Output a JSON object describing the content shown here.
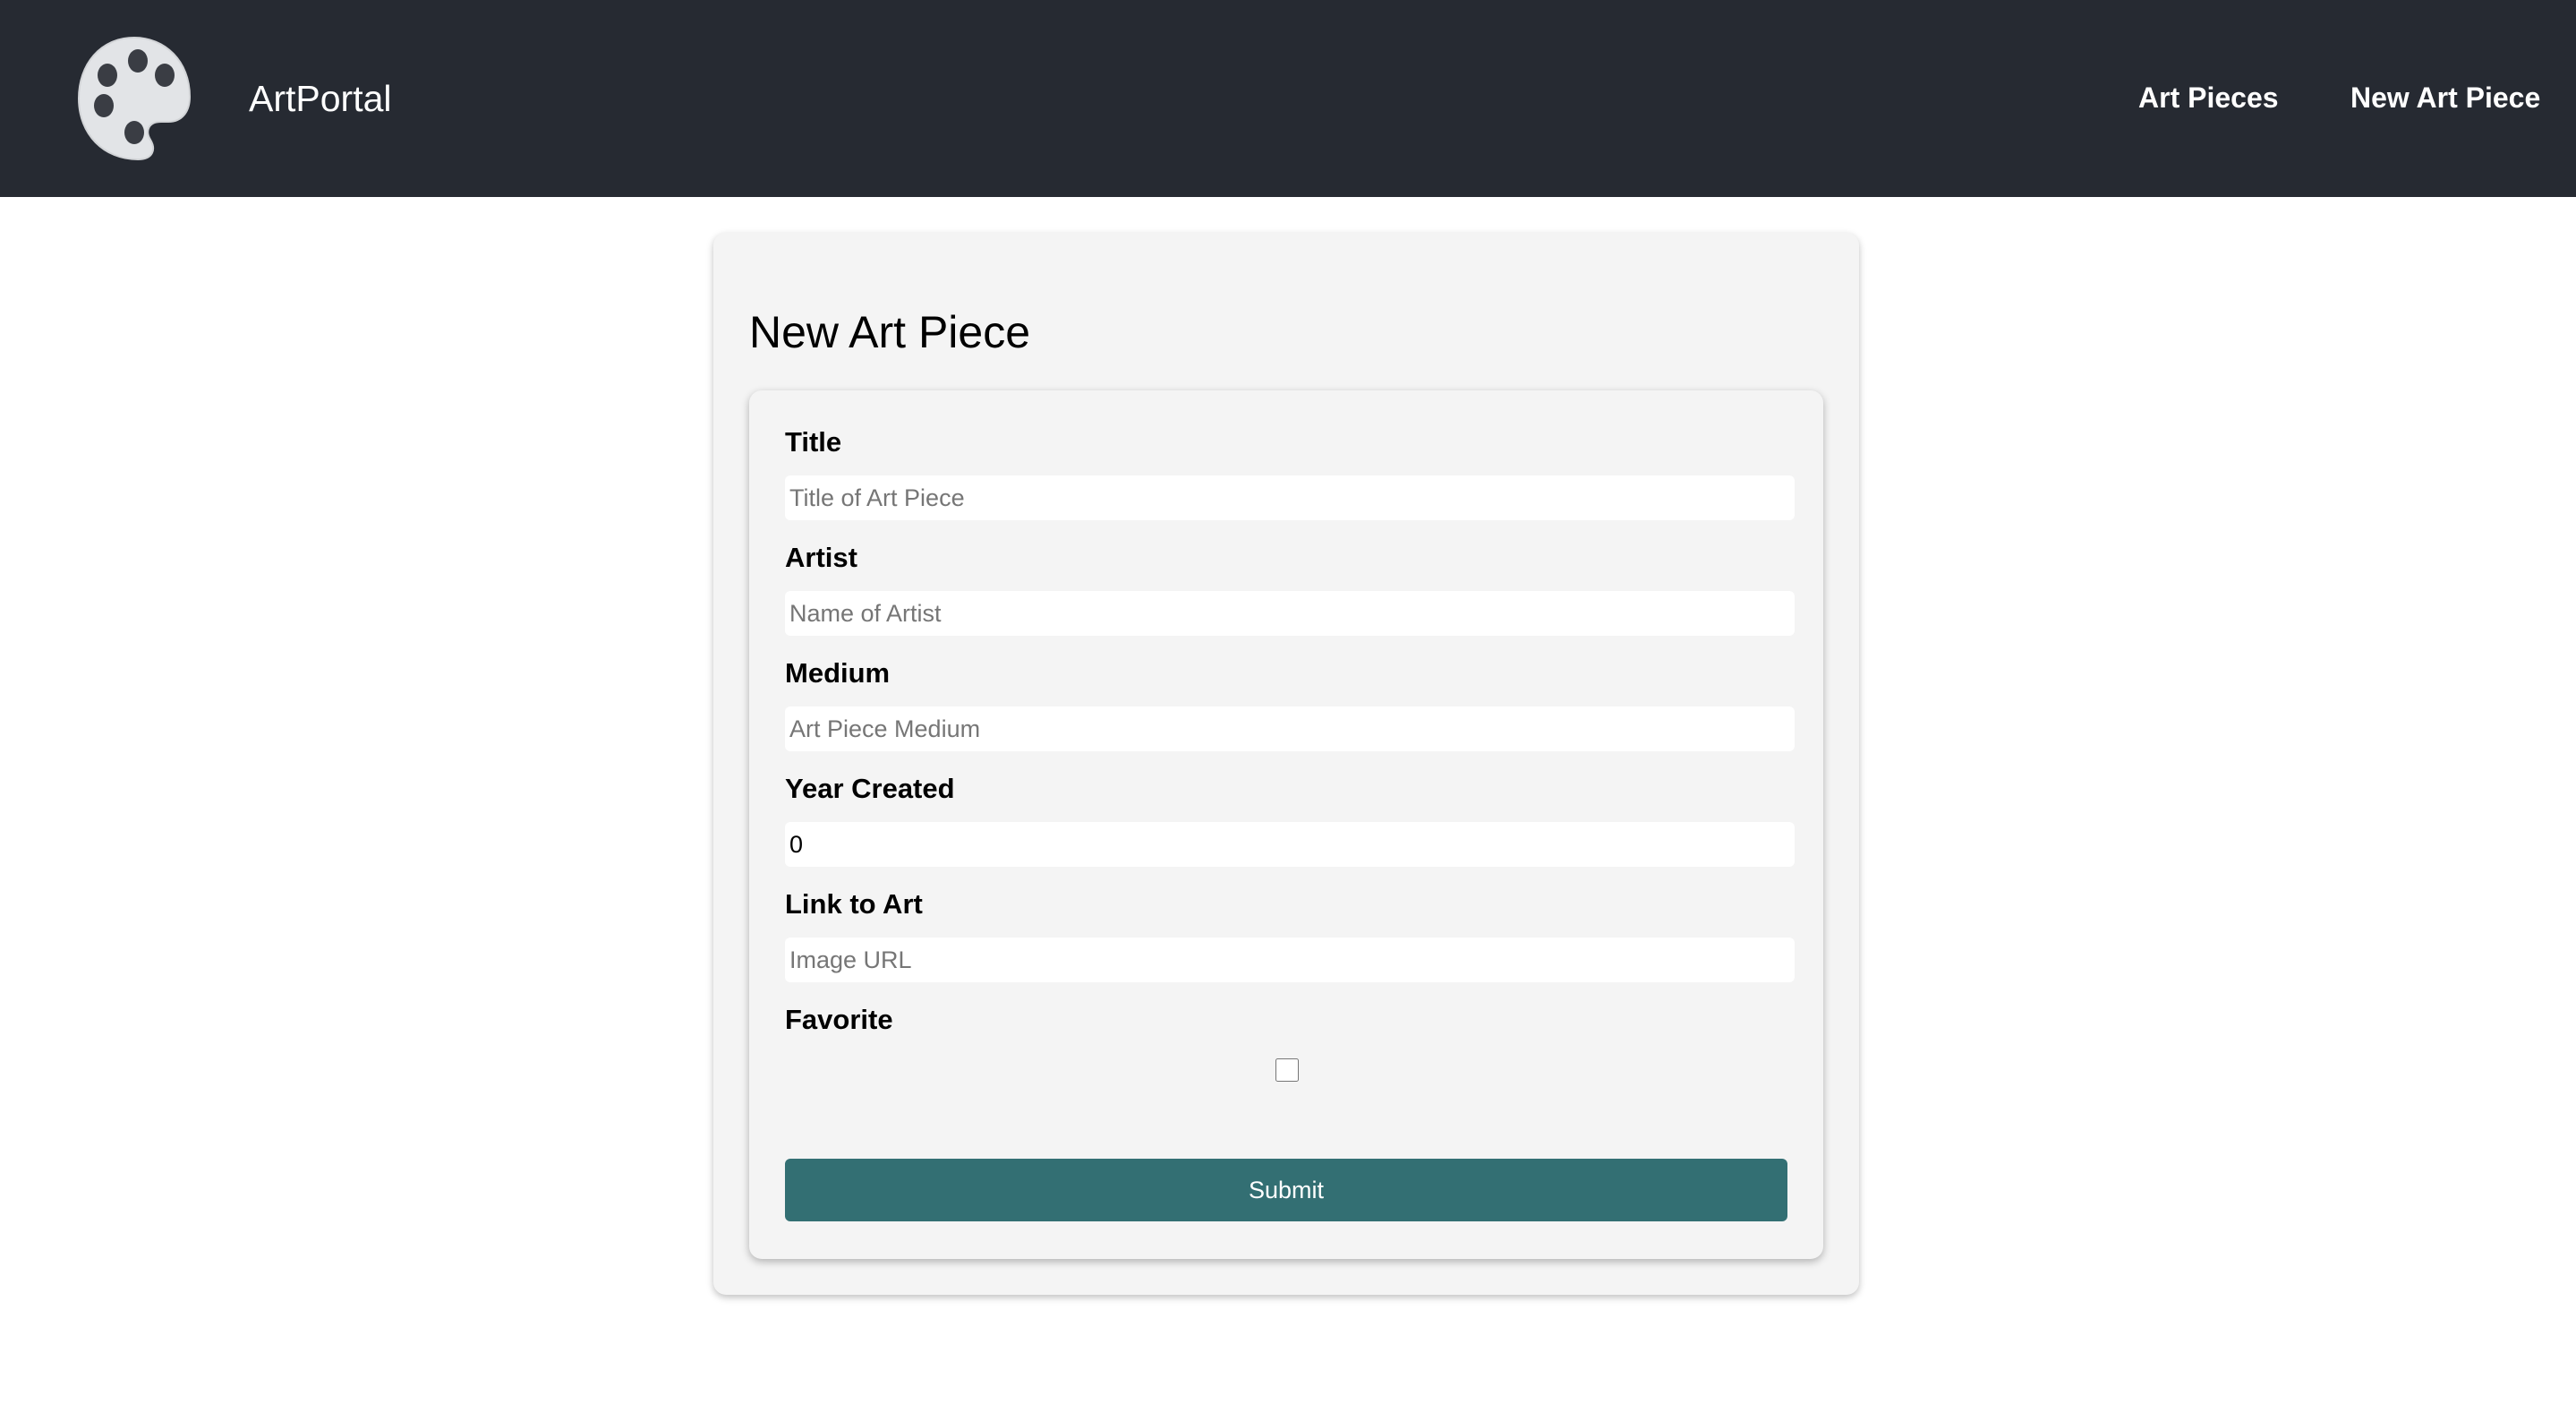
{
  "header": {
    "brand": "ArtPortal",
    "logo_icon": "palette-icon",
    "nav": [
      {
        "label": "Art Pieces"
      },
      {
        "label": "New Art Piece"
      }
    ],
    "background_color": "#262a32"
  },
  "main": {
    "title": "New Art Piece",
    "form": {
      "fields": [
        {
          "label": "Title",
          "value": "",
          "placeholder": "Title of Art Piece"
        },
        {
          "label": "Artist",
          "value": "",
          "placeholder": "Name of Artist"
        },
        {
          "label": "Medium",
          "value": "",
          "placeholder": "Art Piece Medium"
        },
        {
          "label": "Year Created",
          "value": "0",
          "placeholder": ""
        },
        {
          "label": "Link to Art",
          "value": "",
          "placeholder": "Image URL"
        }
      ],
      "favorite": {
        "label": "Favorite",
        "checked": false
      },
      "submit_label": "Submit",
      "submit_color": "#336f73"
    }
  }
}
